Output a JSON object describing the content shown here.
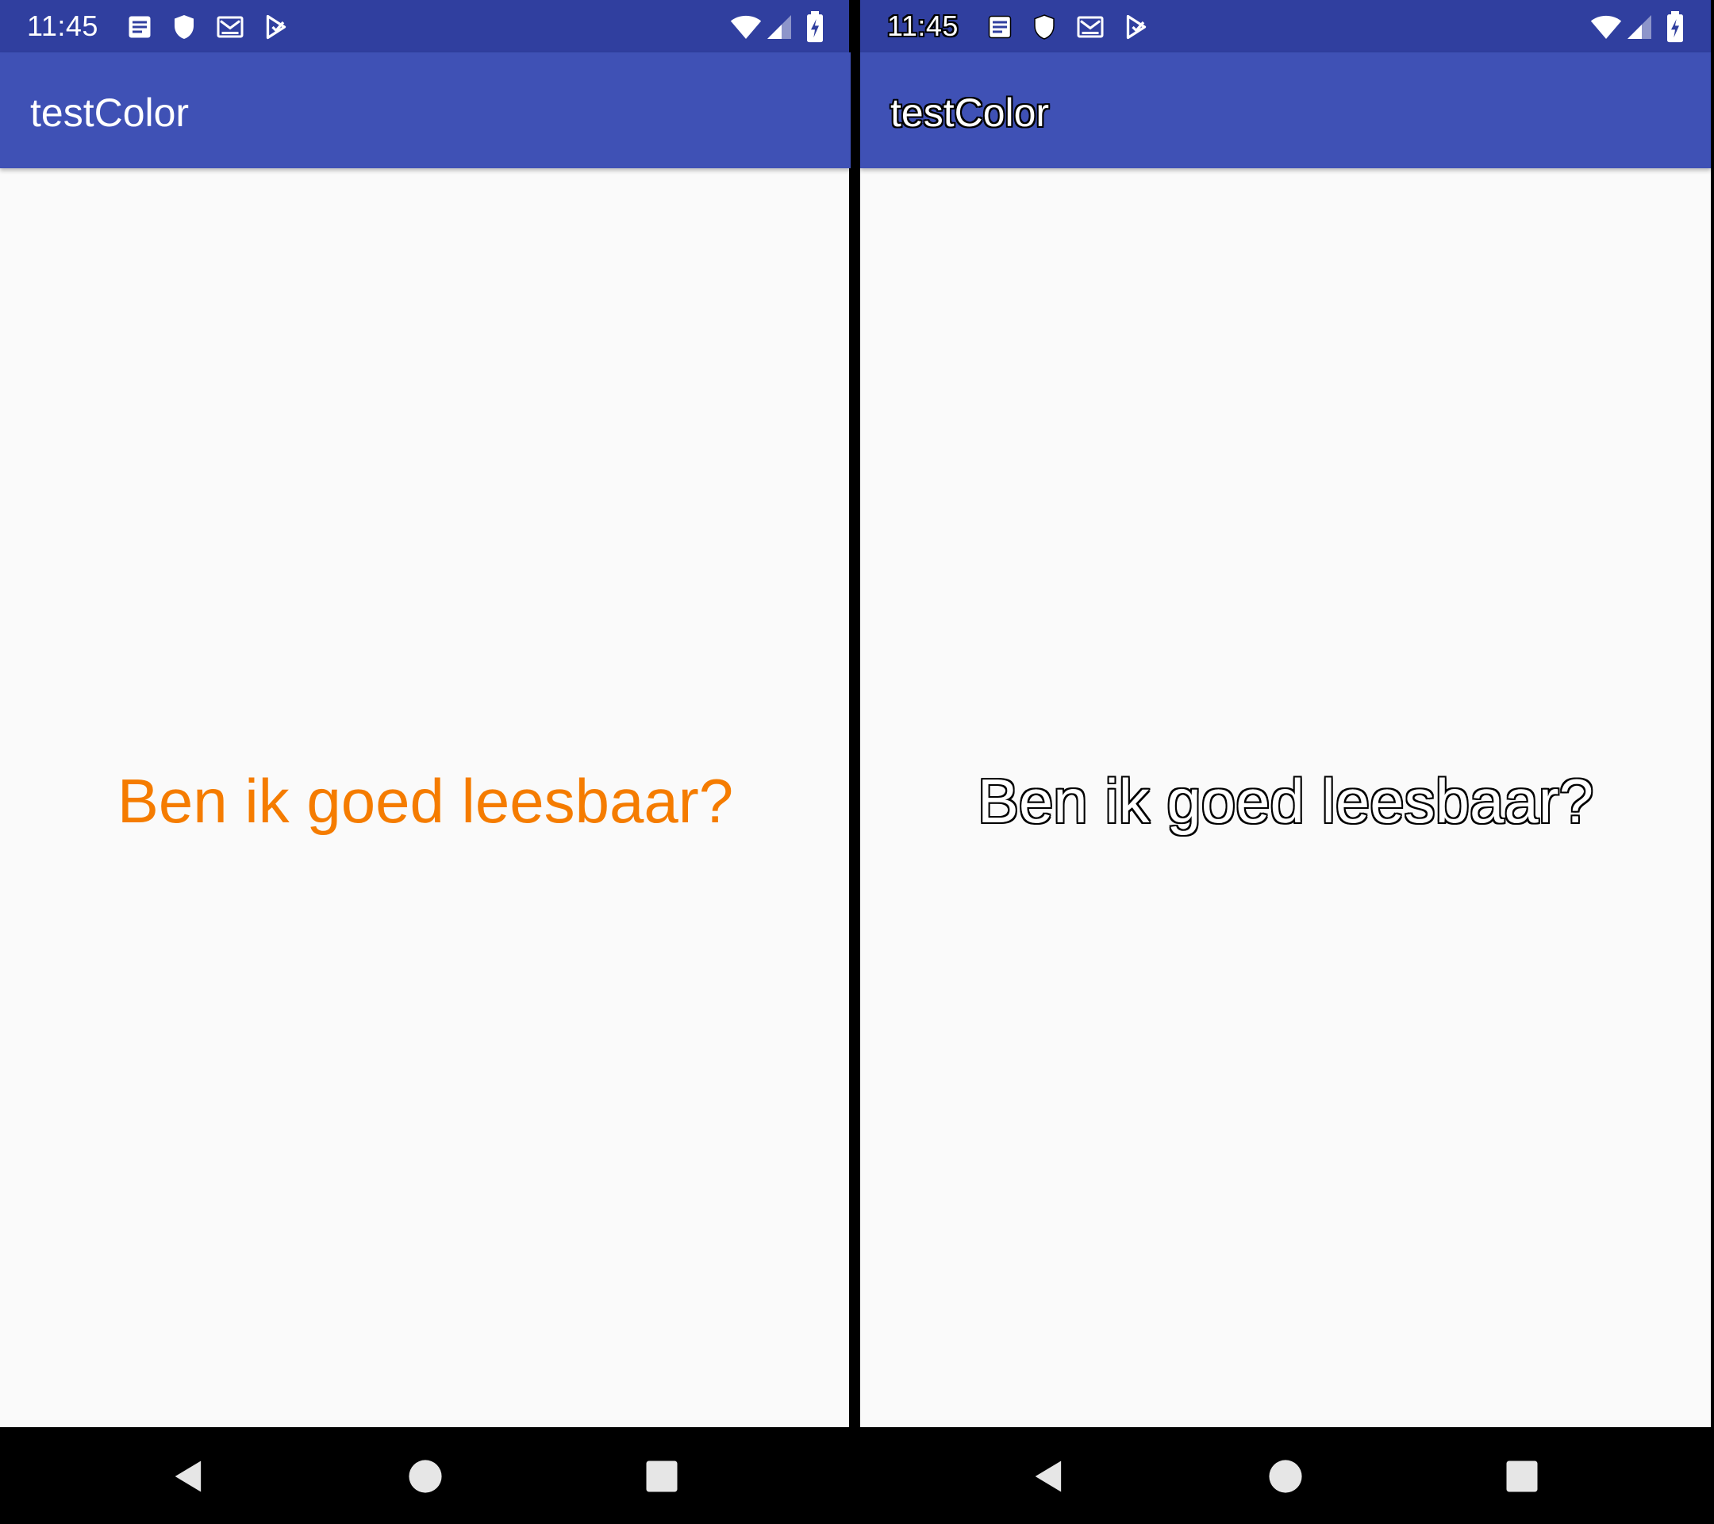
{
  "left_screen": {
    "status_bar": {
      "time": "11:45",
      "icons": [
        "notes-icon",
        "shield-icon",
        "gmail-icon",
        "play-store-icon",
        "wifi-icon",
        "cell-signal-icon",
        "battery-charging-icon"
      ]
    },
    "app_bar": {
      "title": "testColor"
    },
    "content": {
      "text": "Ben ik goed leesbaar?",
      "text_color": "#f57c00"
    },
    "nav_bar": {
      "buttons": [
        "back-icon",
        "home-icon",
        "recents-icon"
      ]
    }
  },
  "right_screen": {
    "status_bar": {
      "time": "11:45",
      "icons": [
        "notes-icon",
        "shield-icon",
        "gmail-icon",
        "play-store-icon",
        "wifi-icon",
        "cell-signal-icon",
        "battery-charging-icon"
      ]
    },
    "app_bar": {
      "title": "testColor"
    },
    "content": {
      "text": "Ben ik goed leesbaar?",
      "text_style": "white with black outline"
    },
    "nav_bar": {
      "buttons": [
        "back-icon",
        "home-icon",
        "recents-icon"
      ]
    }
  },
  "colors": {
    "status_bar": "#303f9f",
    "app_bar": "#3f51b5",
    "content_bg": "#fafafa",
    "nav_bar": "#000000",
    "accent_text": "#f57c00"
  }
}
